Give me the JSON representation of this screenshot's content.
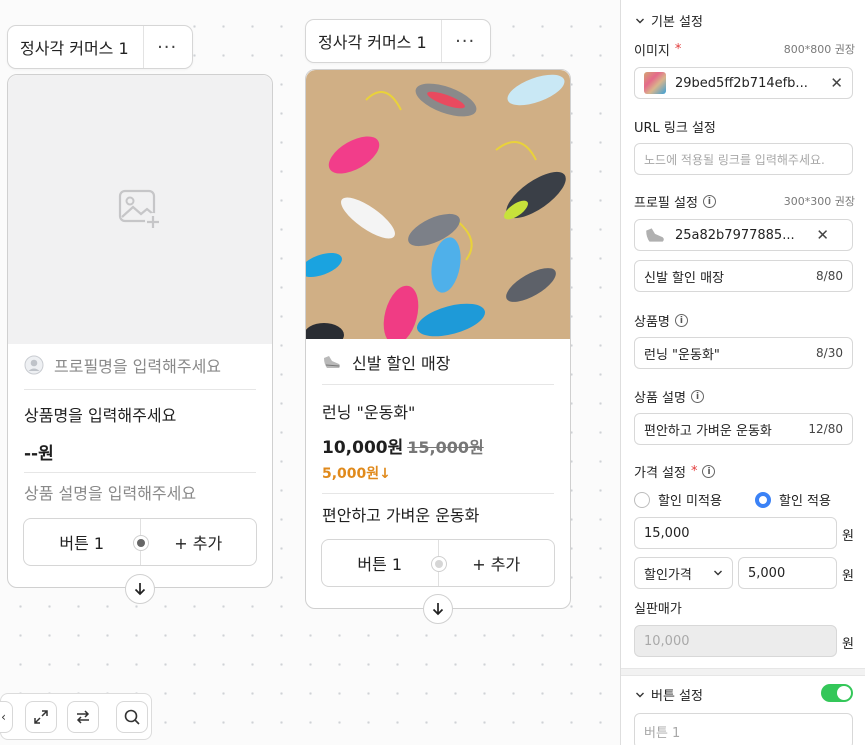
{
  "canvas": {
    "node1": {
      "title": "정사각 커머스 1",
      "more": "···",
      "profile_placeholder": "프로필명을 입력해주세요",
      "product_placeholder": "상품명을 입력해주세요",
      "price_placeholder": "--원",
      "desc_placeholder": "상품 설명을 입력해주세요",
      "button_label": "버튼 1",
      "add_label": "+ 추가"
    },
    "node2": {
      "title": "정사각 커머스 1",
      "more": "···",
      "profile_name": "신발 할인 매장",
      "product_name": "런닝 \"운동화\"",
      "price": "10,000원",
      "old_price": "15,000원",
      "discount": "5,000원↓",
      "description": "편안하고 가벼운 운동화",
      "button_label": "버튼 1",
      "add_label": "+ 추가"
    }
  },
  "panel": {
    "basic_section": "기본 설정",
    "image_label": "이미지",
    "required_mark": "*",
    "image_hint": "800*800 권장",
    "image_file": "29bed5ff2b714efb...",
    "url_label": "URL 링크 설정",
    "url_placeholder": "노드에 적용될 링크를 입력해주세요.",
    "profile_label": "프로필 설정",
    "profile_hint": "300*300 권장",
    "profile_file": "25a82b7977885...",
    "profile_name": "신발 할인 매장",
    "profile_count": "8/80",
    "product_label": "상품명",
    "product_name": "런닝 \"운동화\"",
    "product_count": "8/30",
    "desc_label": "상품 설명",
    "desc_value": "편안하고 가벼운 운동화",
    "desc_count": "12/80",
    "price_label": "가격 설정",
    "radio_off": "할인 미적용",
    "radio_on": "할인 적용",
    "price_value": "15,000",
    "currency": "원",
    "discount_type": "할인가격",
    "discount_value": "5,000",
    "final_label": "실판매가",
    "final_value": "10,000",
    "button_section": "버튼 설정",
    "button_placeholder": "버튼 1"
  },
  "icons": [
    "image-plus-icon",
    "avatar-icon",
    "shoe-icon",
    "arrow-down-icon",
    "expand-icon",
    "swap-icon",
    "search-icon",
    "chevron-down-icon",
    "close-icon",
    "info-icon"
  ],
  "colors": {
    "accent": "#3b82f6",
    "discount": "#e08a1c",
    "toggle_on": "#34c759",
    "required": "#e23a3a"
  }
}
